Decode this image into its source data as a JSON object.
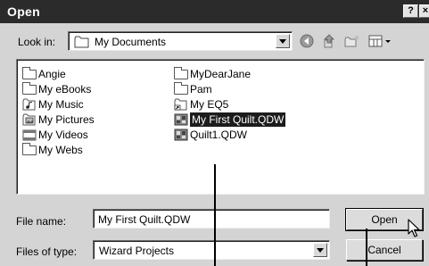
{
  "window": {
    "title": "Open",
    "help_label": "?",
    "close_label": "×"
  },
  "look_in": {
    "label": "Look in:",
    "value": "My Documents",
    "icon": "folder-icon",
    "toolbar": [
      "back-icon",
      "up-folder-icon",
      "new-folder-icon",
      "view-menu-icon"
    ]
  },
  "files": {
    "column1": [
      {
        "name": "Angie",
        "icon": "folder-icon"
      },
      {
        "name": "My eBooks",
        "icon": "folder-icon"
      },
      {
        "name": "My Music",
        "icon": "music-folder-icon"
      },
      {
        "name": "My Pictures",
        "icon": "pictures-folder-icon"
      },
      {
        "name": "My Videos",
        "icon": "videos-folder-icon"
      },
      {
        "name": "My Webs",
        "icon": "folder-icon"
      }
    ],
    "column2": [
      {
        "name": "MyDearJane",
        "icon": "folder-icon"
      },
      {
        "name": "Pam",
        "icon": "folder-icon"
      },
      {
        "name": "My EQ5",
        "icon": "shortcut-icon"
      },
      {
        "name": "My First Quilt.QDW",
        "icon": "quilt-file-icon",
        "selected": true
      },
      {
        "name": "Quilt1.QDW",
        "icon": "quilt-file-icon"
      }
    ]
  },
  "file_name": {
    "label": "File name:",
    "value": "My First Quilt.QDW"
  },
  "file_type": {
    "label": "Files of type:",
    "value": "Wizard Projects"
  },
  "buttons": {
    "open": "Open",
    "cancel": "Cancel"
  },
  "colors": {
    "titlebar": "#2b2b2b",
    "selection": "#1c1c1c",
    "dialog": "#d4d4d4"
  }
}
